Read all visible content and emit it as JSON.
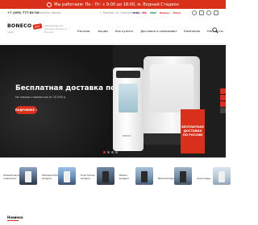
{
  "topbar": {
    "text": "Мы работаем: Пн - Пт: с 9:00 до 18:00, м. Водный Стадион",
    "bg": "#d8301b"
  },
  "infobar": {
    "phone": "+7 (495) 777-83-38",
    "callback": "Заказать звонок",
    "city": "г. Москва, ул. Смольная, д. 24",
    "payments": [
      "VISA",
      "MC",
      "МИР",
      "Яндекс",
      "Halva"
    ]
  },
  "header": {
    "logo": "BONECO",
    "logo_badge": "best",
    "logo_sub": "Swiss",
    "tagline": "Официальный магазин Boneco в России",
    "nav": [
      "Каталог",
      "Акции",
      "Как купить",
      "Доставка и самовывоз",
      "Компания",
      "Контакты"
    ]
  },
  "hero": {
    "headline": "Бесплатная доставка по России!",
    "subline": "На заказы стоимостью от 10 000 р.",
    "cta": "ПОДРОБНЕЕ",
    "stamp": "БЕСПЛАТНАЯ ДОСТАВКА ПО РОССИИ",
    "device_logo": "BONECO",
    "slides": 4,
    "active_slide": 1
  },
  "categories": [
    {
      "label": "Климатические комплексы"
    },
    {
      "label": "Увлажнители воздуха"
    },
    {
      "label": "Очистители воздуха"
    },
    {
      "label": "Мойки воздуха"
    },
    {
      "label": "Вентиляторы"
    },
    {
      "label": "Аксессуары"
    }
  ],
  "news": {
    "title": "Новинка"
  },
  "colors": {
    "accent": "#d8301b",
    "hero_bg": "#1e1e1e"
  }
}
